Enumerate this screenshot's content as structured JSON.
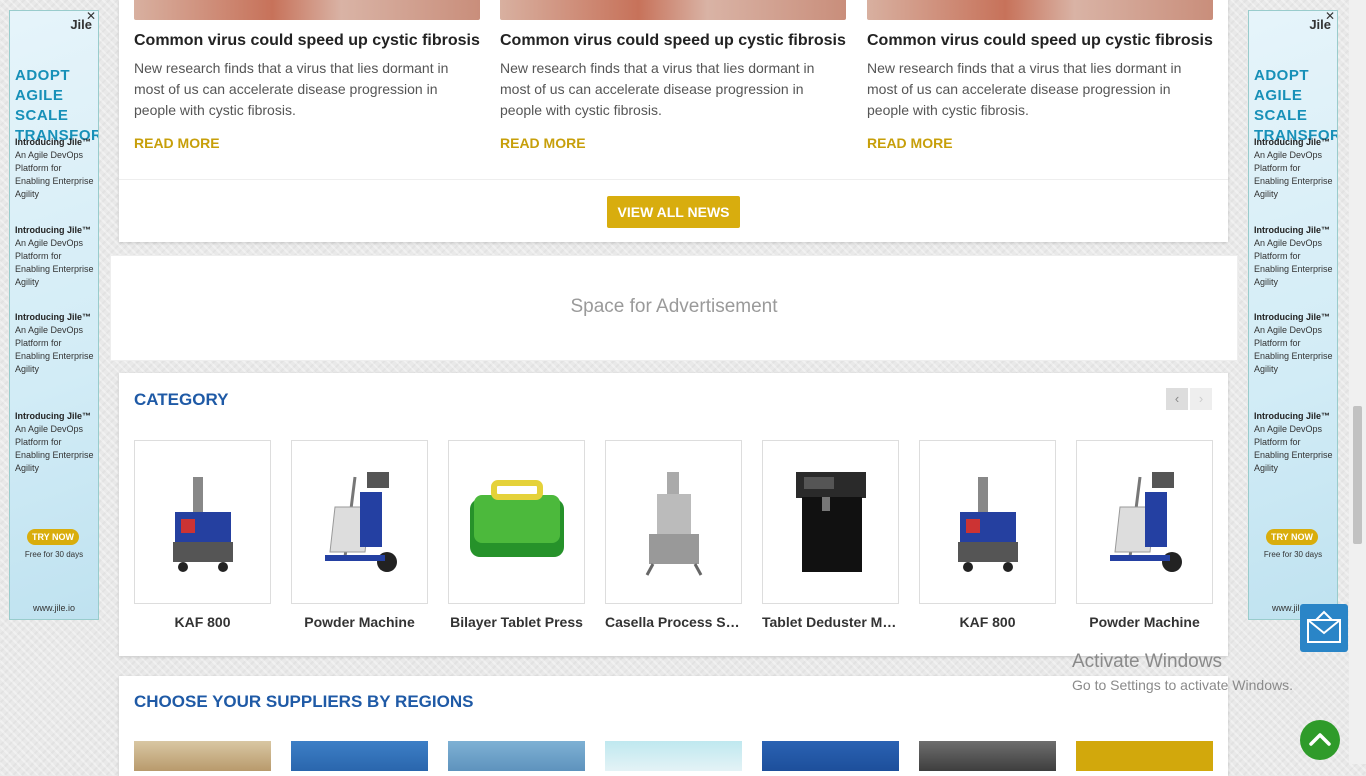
{
  "news": {
    "items": [
      {
        "title": "Common virus could speed up cystic fibrosis",
        "desc": "New research finds that a virus that lies dormant in most of us can accelerate disease progression in people with cystic fibrosis.",
        "more": "READ MORE"
      },
      {
        "title": "Common virus could speed up cystic fibrosis",
        "desc": "New research finds that a virus that lies dormant in most of us can accelerate disease progression in people with cystic fibrosis.",
        "more": "READ MORE"
      },
      {
        "title": "Common virus could speed up cystic fibrosis",
        "desc": "New research finds that a virus that lies dormant in most of us can accelerate disease progression in people with cystic fibrosis.",
        "more": "READ MORE"
      }
    ],
    "view_all": "VIEW ALL NEWS"
  },
  "ad_space": {
    "text": "Space for Advertisement"
  },
  "category": {
    "title": "CATEGORY",
    "prev": "‹",
    "next": "›",
    "items": [
      {
        "name": "KAF 800",
        "icon": "extruder-machine-icon"
      },
      {
        "name": "Powder Machine",
        "icon": "powder-machine-icon"
      },
      {
        "name": "Bilayer Tablet Press",
        "icon": "tablet-press-icon"
      },
      {
        "name": "Casella Process Sol...",
        "icon": "process-machine-icon"
      },
      {
        "name": "Tablet Deduster Ma...",
        "icon": "deduster-icon"
      },
      {
        "name": "KAF 800",
        "icon": "extruder-machine-icon"
      },
      {
        "name": "Powder Machine",
        "icon": "powder-machine-icon"
      }
    ]
  },
  "regions": {
    "title": "CHOOSE YOUR SUPPLIERS BY REGIONS"
  },
  "side_ad": {
    "logo": "Jile",
    "close": "✕",
    "headline": [
      "ADOPT AGILE",
      "SCALE",
      "TRANSFORM"
    ],
    "promo_title": "Introducing Jile™",
    "promo_text": "An Agile DevOps Platform for Enabling Enterprise Agility",
    "try": "TRY NOW",
    "free": "Free for 30 days",
    "site": "www.jile.io"
  },
  "activate": {
    "line1": "Activate Windows",
    "line2": "Go to Settings to activate Windows."
  },
  "colors": {
    "accent": "#d8ad0e",
    "title_blue": "#1f5aa6"
  }
}
